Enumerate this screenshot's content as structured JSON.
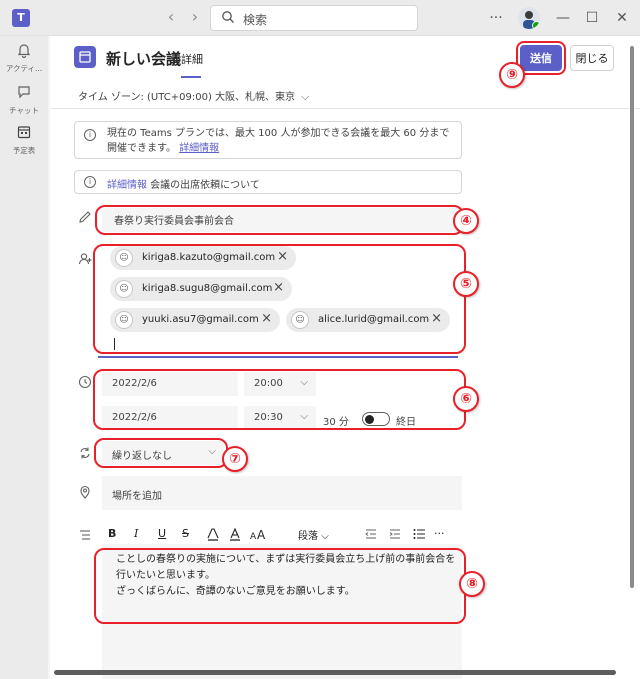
{
  "titlebar": {
    "search_placeholder": "検索",
    "more_label": "···",
    "minimize": "—",
    "maximize": "☐",
    "close": "✕"
  },
  "rail": {
    "items": [
      {
        "label": "アクティ...",
        "icon": "bell-icon"
      },
      {
        "label": "チャット",
        "icon": "chat-icon"
      },
      {
        "label": "予定表",
        "icon": "calendar-icon"
      }
    ]
  },
  "header": {
    "title": "新しい会議",
    "tab": "詳細",
    "send_label": "送信",
    "close_label": "閉じる"
  },
  "timezone": "タイム ゾーン: (UTC+09:00) 大阪、札幌、東京",
  "notices": {
    "plan_text": "現在の Teams プランでは、最大 100 人が参加できる会議を最大 60 分まで開催できます。",
    "plan_link": "詳細情報",
    "rsvp_link": "詳細情報",
    "rsvp_text": " 会議の出席依頼について"
  },
  "meeting_title": "春祭り実行委員会事前会合",
  "attendees": [
    "kiriga8.kazuto@gmail.com",
    "kiriga8.sugu8@gmail.com",
    "yuuki.asu7@gmail.com",
    "alice.lurid@gmail.com"
  ],
  "schedule": {
    "start_date": "2022/2/6",
    "start_time": "20:00",
    "end_date": "2022/2/6",
    "end_time": "20:30",
    "duration": "30 分",
    "all_day_label": "終日"
  },
  "repeat": "繰り返しなし",
  "location_placeholder": "場所を追加",
  "toolbar": {
    "bold": "B",
    "italic": "I",
    "underline": "U",
    "strike": "S",
    "paragraph": "段落"
  },
  "body": {
    "line1": "ことしの春祭りの実施について、まずは実行委員会立ち上げ前の事前会合を行いたいと思います。",
    "line2": "ざっくばらんに、奇譚のないご意見をお願いします。"
  },
  "annotations": [
    "④",
    "⑤",
    "⑥",
    "⑦",
    "⑧",
    "⑨"
  ],
  "colors": {
    "accent": "#5b5fc7",
    "annotation_red": "#e8202a"
  }
}
